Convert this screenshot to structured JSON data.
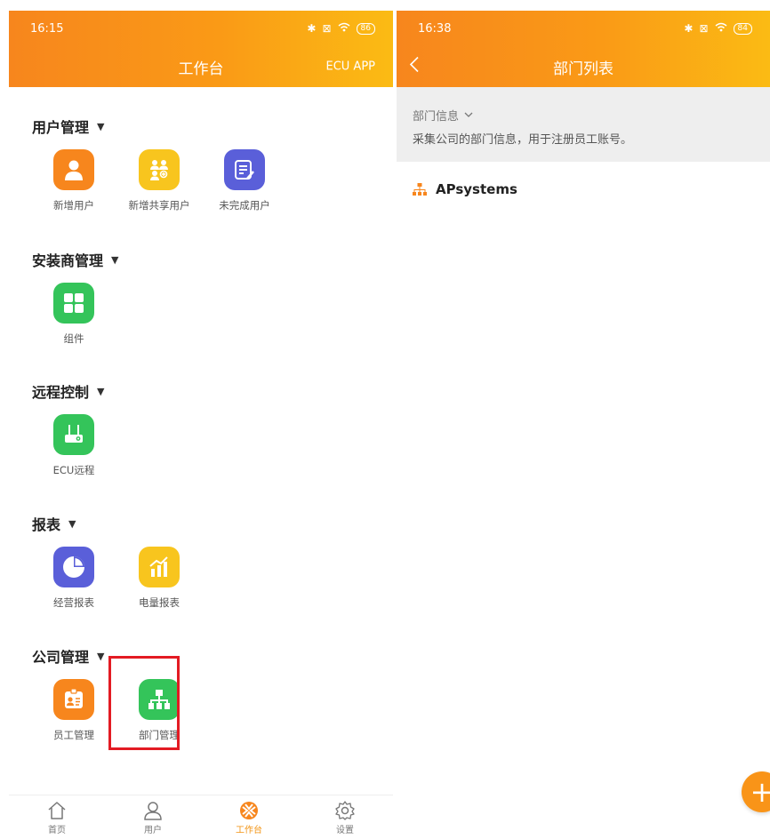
{
  "left": {
    "status": {
      "time": "16:15",
      "battery": "86"
    },
    "title": "工作台",
    "app_link": "ECU APP",
    "sections": [
      {
        "title": "用户管理",
        "tiles": [
          {
            "label": "新增用户",
            "icon": "person-icon",
            "color": "#f7861d"
          },
          {
            "label": "新增共享用户",
            "icon": "shared-users-icon",
            "color": "#f8c51e"
          },
          {
            "label": "未完成用户",
            "icon": "edit-list-icon",
            "color": "#5a5fd9"
          }
        ]
      },
      {
        "title": "安装商管理",
        "tiles": [
          {
            "label": "组件",
            "icon": "grid-icon",
            "color": "#34c45a"
          }
        ]
      },
      {
        "title": "远程控制",
        "tiles": [
          {
            "label": "ECU远程",
            "icon": "router-settings-icon",
            "color": "#34c45a"
          }
        ]
      },
      {
        "title": "报表",
        "tiles": [
          {
            "label": "经营报表",
            "icon": "pie-chart-icon",
            "color": "#5a5fd9"
          },
          {
            "label": "电量报表",
            "icon": "bar-chart-icon",
            "color": "#f8c51e"
          }
        ]
      },
      {
        "title": "公司管理",
        "tiles": [
          {
            "label": "员工管理",
            "icon": "id-badge-icon",
            "color": "#f7861d"
          },
          {
            "label": "部门管理",
            "icon": "org-chart-icon",
            "color": "#34c45a"
          }
        ]
      }
    ],
    "nav": [
      {
        "label": "首页",
        "icon": "home-icon"
      },
      {
        "label": "用户",
        "icon": "user-icon"
      },
      {
        "label": "工作台",
        "icon": "workbench-icon",
        "active": true
      },
      {
        "label": "设置",
        "icon": "settings-icon"
      }
    ]
  },
  "right": {
    "status": {
      "time": "16:38",
      "battery": "84"
    },
    "title": "部门列表",
    "info_title": "部门信息",
    "info_desc": "采集公司的部门信息，用于注册员工账号。",
    "departments": [
      {
        "name": "APsystems",
        "icon": "org-chart-icon"
      }
    ],
    "fab": "+"
  },
  "colors": {
    "accent": "#f7861d",
    "accent_end": "#fbbb14",
    "highlight": "#e31b23"
  }
}
